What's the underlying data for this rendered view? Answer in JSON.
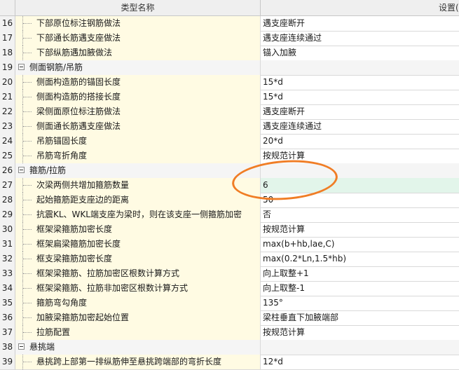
{
  "header": {
    "name_col": "类型名称",
    "value_col": "设置("
  },
  "rows": [
    {
      "n": "16",
      "kind": "child",
      "name": "下部原位标注钢筋做法",
      "value": "遇支座断开"
    },
    {
      "n": "17",
      "kind": "child",
      "name": "下部通长筋遇支座做法",
      "value": "遇支座连续通过"
    },
    {
      "n": "18",
      "kind": "child",
      "name": "下部纵筋遇加腋做法",
      "value": "锚入加腋"
    },
    {
      "n": "19",
      "kind": "group",
      "name": "侧面钢筋/吊筋",
      "value": ""
    },
    {
      "n": "20",
      "kind": "child",
      "name": "侧面构造筋的锚固长度",
      "value": "15*d"
    },
    {
      "n": "21",
      "kind": "child",
      "name": "侧面构造筋的搭接长度",
      "value": "15*d"
    },
    {
      "n": "22",
      "kind": "child",
      "name": "梁侧面原位标注筋做法",
      "value": "遇支座断开"
    },
    {
      "n": "23",
      "kind": "child",
      "name": "侧面通长筋遇支座做法",
      "value": "遇支座连续通过"
    },
    {
      "n": "24",
      "kind": "child",
      "name": "吊筋锚固长度",
      "value": "20*d"
    },
    {
      "n": "25",
      "kind": "child",
      "name": "吊筋弯折角度",
      "value": "按规范计算"
    },
    {
      "n": "26",
      "kind": "group",
      "name": "箍筋/拉筋",
      "value": ""
    },
    {
      "n": "27",
      "kind": "child",
      "name": "次梁两侧共增加箍筋数量",
      "value": "6",
      "selected": true
    },
    {
      "n": "28",
      "kind": "child",
      "name": "起始箍筋距支座边的距离",
      "value": "50"
    },
    {
      "n": "29",
      "kind": "child",
      "name": "抗震KL、WKL端支座为梁时，则在该支座一侧箍筋加密",
      "value": "否"
    },
    {
      "n": "30",
      "kind": "child",
      "name": "框架梁箍筋加密长度",
      "value": "按规范计算"
    },
    {
      "n": "31",
      "kind": "child",
      "name": "框架扁梁箍筋加密长度",
      "value": "max(b+hb,lae,C)"
    },
    {
      "n": "32",
      "kind": "child",
      "name": "框支梁箍筋加密长度",
      "value": "max(0.2*Ln,1.5*hb)"
    },
    {
      "n": "33",
      "kind": "child",
      "name": "框架梁箍筋、拉筋加密区根数计算方式",
      "value": "向上取整+1"
    },
    {
      "n": "34",
      "kind": "child",
      "name": "框架梁箍筋、拉筋非加密区根数计算方式",
      "value": "向上取整-1"
    },
    {
      "n": "35",
      "kind": "child",
      "name": "箍筋弯勾角度",
      "value": "135°"
    },
    {
      "n": "36",
      "kind": "child",
      "name": "加腋梁箍筋加密起始位置",
      "value": "梁柱垂直下加腋端部"
    },
    {
      "n": "37",
      "kind": "child",
      "name": "拉筋配置",
      "value": "按规范计算"
    },
    {
      "n": "38",
      "kind": "group",
      "name": "悬挑端",
      "value": ""
    },
    {
      "n": "39",
      "kind": "child",
      "name": "悬挑跨上部第一排纵筋伸至悬挑跨端部的弯折长度",
      "value": "12*d"
    }
  ],
  "colors": {
    "annotation": "#f07d25",
    "selected_value_bg": "#e2f5ea",
    "child_name_bg": "#fffbe3"
  }
}
